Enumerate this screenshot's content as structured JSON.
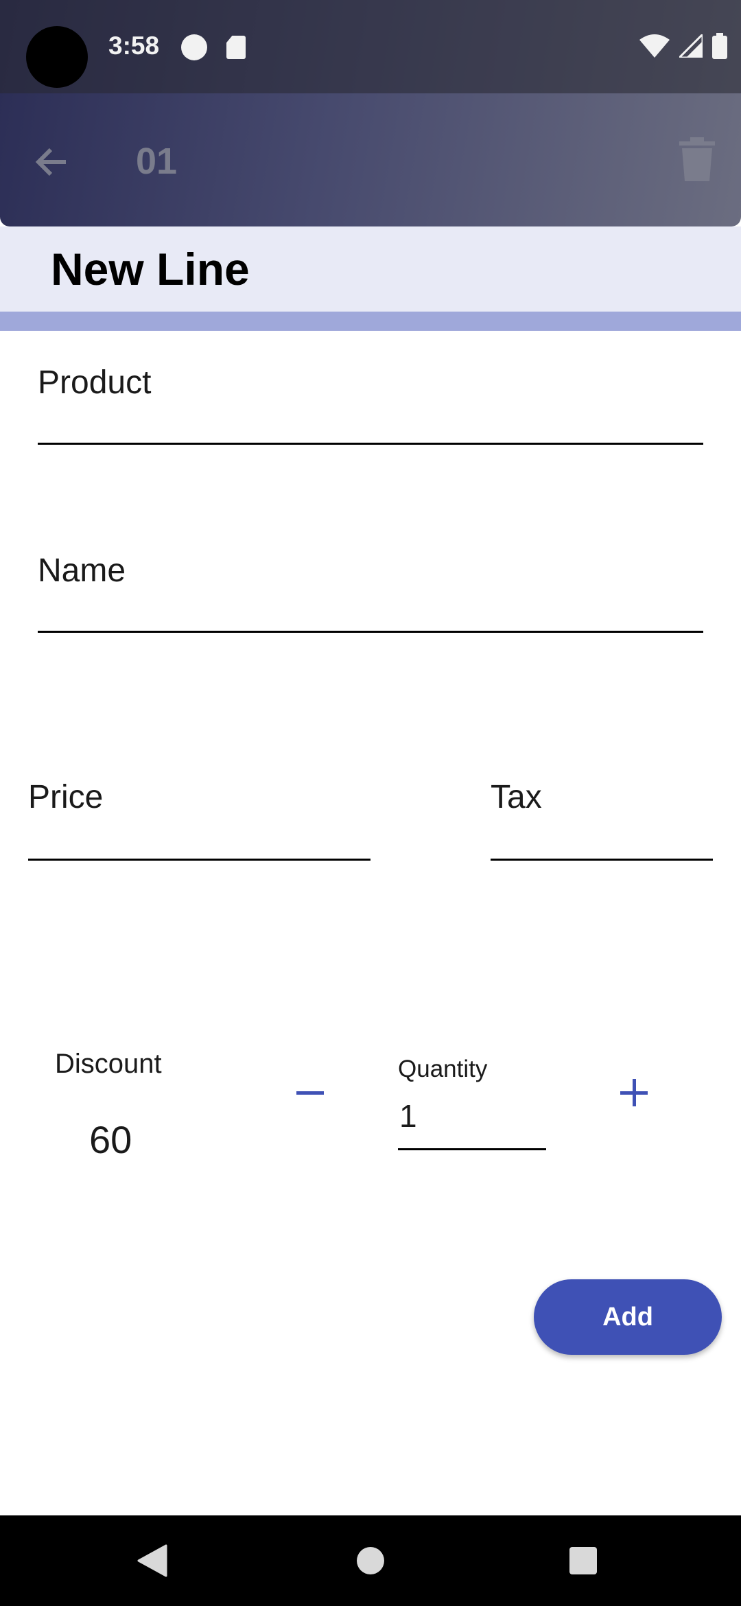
{
  "status_bar": {
    "time": "3:58",
    "icons": [
      "camera-cutout",
      "app-notification-icon",
      "sd-card-icon",
      "wifi-icon",
      "signal-icon",
      "battery-icon"
    ]
  },
  "background_screen": {
    "title": "01",
    "back_icon": "arrow-back-icon",
    "delete_icon": "trash-icon"
  },
  "sheet": {
    "title": "New Line",
    "fields": {
      "product": {
        "label": "Product",
        "value": ""
      },
      "name": {
        "label": "Name",
        "value": ""
      },
      "price": {
        "label": "Price",
        "value": ""
      },
      "tax": {
        "label": "Tax",
        "value": ""
      }
    },
    "discount": {
      "label": "Discount",
      "value": "60"
    },
    "quantity": {
      "label": "Quantity",
      "value": "1"
    },
    "add_button": "Add"
  },
  "nav_bar": {
    "icons": [
      "nav-back-icon",
      "nav-home-icon",
      "nav-recents-icon"
    ]
  },
  "colors": {
    "primary": "#3f51b5",
    "sheet_header_bg": "#e8eaf6",
    "divider": "#9fa8da"
  }
}
